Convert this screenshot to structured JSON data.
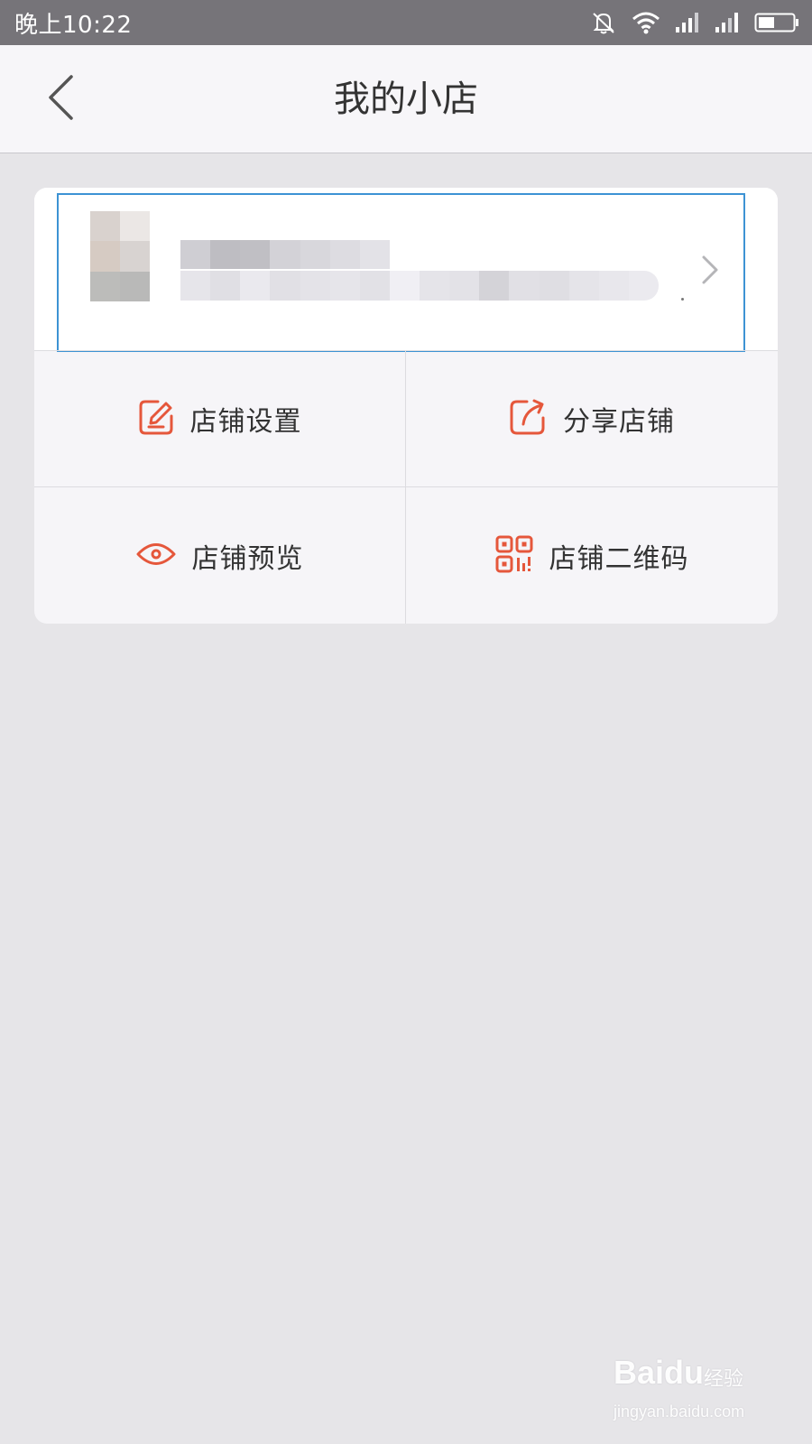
{
  "status_bar": {
    "time": "晚上10:22",
    "icons": [
      "mute-icon",
      "wifi-icon",
      "signal-icon",
      "signal-icon",
      "battery-icon"
    ]
  },
  "nav": {
    "title": "我的小店",
    "back_icon": "chevron-left-icon"
  },
  "shop": {
    "arrow_icon": "chevron-right-icon",
    "highlight_color": "#3d93d4"
  },
  "actions": [
    {
      "label": "店铺设置",
      "icon": "edit-icon"
    },
    {
      "label": "分享店铺",
      "icon": "share-icon"
    },
    {
      "label": "店铺预览",
      "icon": "eye-icon"
    },
    {
      "label": "店铺二维码",
      "icon": "qr-code-icon"
    }
  ],
  "colors": {
    "accent": "#e5573b",
    "background": "#e6e5e8",
    "status_bar": "#767479"
  },
  "watermark": {
    "logo": "Baidu",
    "sub": "经验",
    "url": "jingyan.baidu.com"
  }
}
